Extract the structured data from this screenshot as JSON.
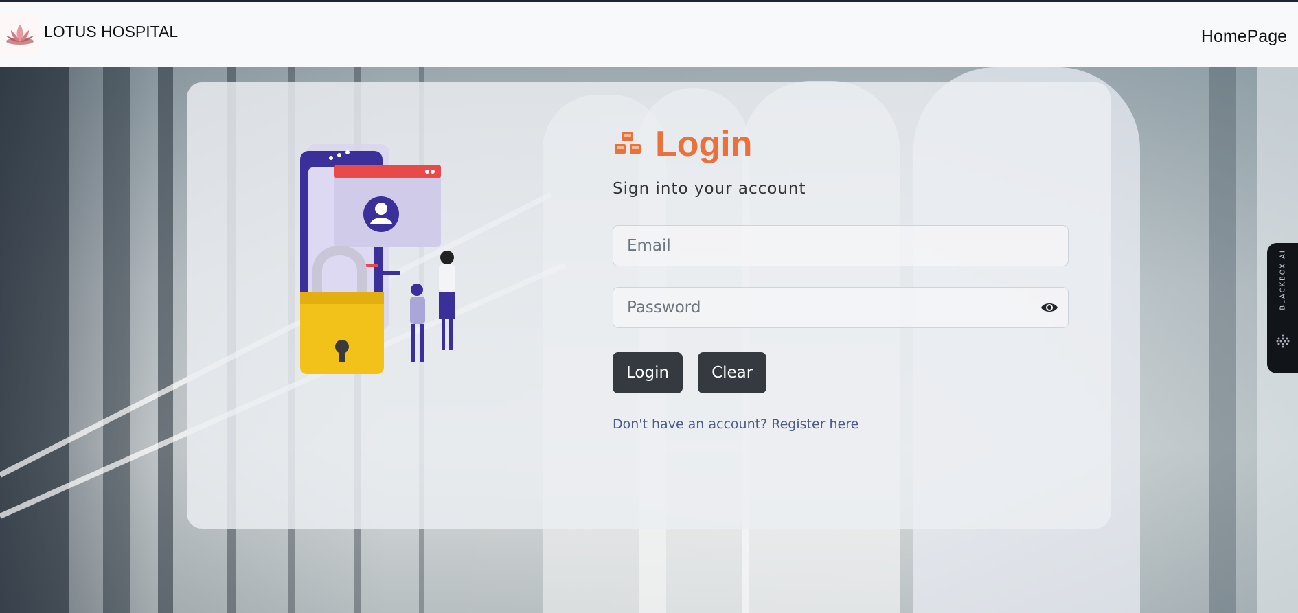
{
  "navbar": {
    "brand_name": "LOTUS HOSPITAL",
    "home_link": "HomePage"
  },
  "login": {
    "title": "Login",
    "subtitle": "Sign into your account",
    "email_placeholder": "Email",
    "password_placeholder": "Password",
    "login_button": "Login",
    "clear_button": "Clear",
    "register_prompt": "Don't have an account?",
    "register_link": "Register here"
  },
  "widget": {
    "label": "BLACKBOX AI"
  },
  "colors": {
    "accent": "#e8713c",
    "button": "#343a40",
    "link": "#4a5a8a"
  }
}
